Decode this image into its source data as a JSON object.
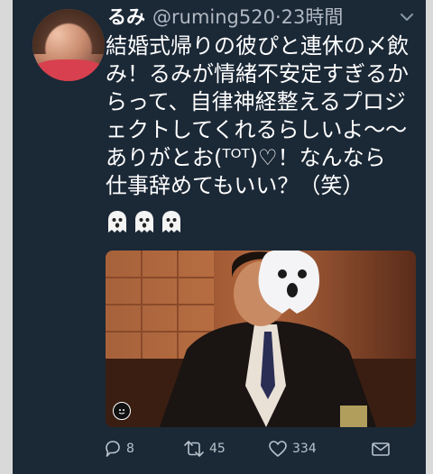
{
  "tweet": {
    "display_name": "るみ",
    "handle": "@ruming520",
    "separator": "·",
    "time": "23時間",
    "text_lines": [
      "結婚式帰りの彼ぴと連休の〆飲",
      "み！るみが情緒不安定すぎるか",
      "らって、自律神経整えるプロジ",
      "ェクトしてくれるらしいよ〜〜",
      "ありがとお(ᵀᴼᵀ)♡！なんなら",
      "仕事辞めてもいい？（笑）"
    ],
    "emojis": [
      "ghost-icon",
      "ghost-icon",
      "ghost-icon"
    ],
    "media_icon": "gif-badge"
  },
  "actions": {
    "reply_count": "8",
    "retweet_count": "45",
    "like_count": "334"
  },
  "colors": {
    "background": "#1b2836",
    "text": "#ffffff",
    "secondary_text": "#b0b8c2",
    "icon": "#b8c3cc"
  }
}
